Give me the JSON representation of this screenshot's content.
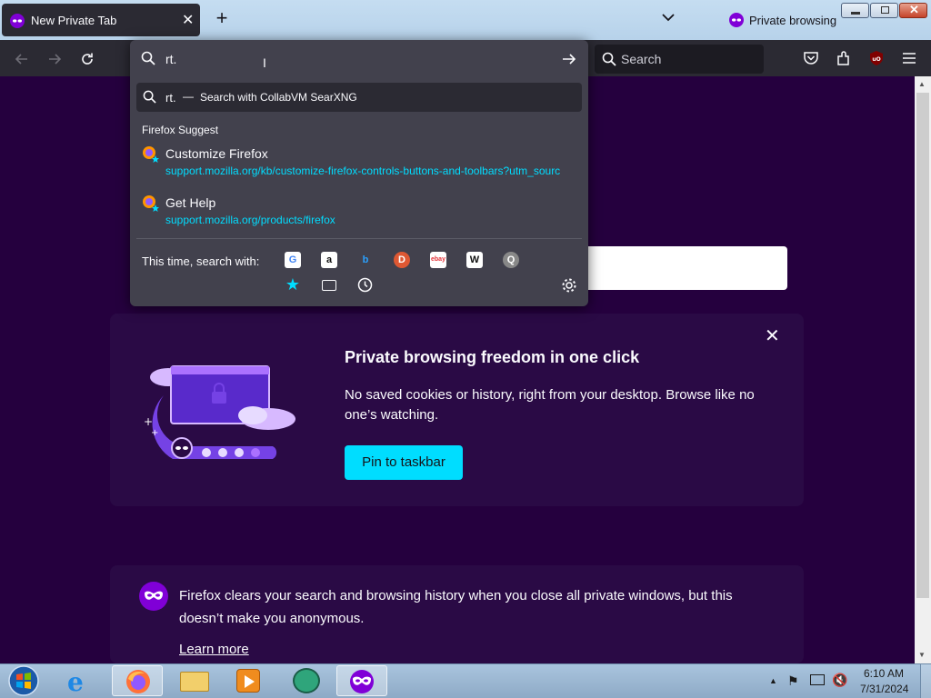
{
  "browser": {
    "tab_title": "New Private Tab",
    "private_label": "Private browsing",
    "search_placeholder": "Search"
  },
  "urlbar": {
    "value": "rt.",
    "search_row": {
      "query": "rt.",
      "separator": "—",
      "action": "Search with CollabVM SearXNG"
    },
    "suggest_heading": "Firefox Suggest",
    "suggestions": [
      {
        "title": "Customize Firefox",
        "url": "support.mozilla.org/kb/customize-firefox-controls-buttons-and-toolbars?utm_sourc"
      },
      {
        "title": "Get Help",
        "url": "support.mozilla.org/products/firefox"
      }
    ],
    "one_off_label": "This time, search with:",
    "engines": [
      "google-icon",
      "amazon-icon",
      "bing-icon",
      "duckduckgo-icon",
      "ebay-icon",
      "wikipedia-icon",
      "searxng-icon"
    ],
    "engine_glyphs": [
      "G",
      "a",
      "b",
      "D",
      "ebay",
      "W",
      "Q"
    ],
    "modes": [
      "bookmarks-icon",
      "tabs-icon",
      "history-icon"
    ]
  },
  "promo": {
    "title": "Private browsing freedom in one click",
    "text": "No saved cookies or history, right from your desktop. Browse like no one’s watching.",
    "button": "Pin to taskbar"
  },
  "info": {
    "text": "Firefox clears your search and browsing history when you close all private windows, but this doesn’t make you anonymous.",
    "link": "Learn more"
  },
  "taskbar": {
    "time": "6:10 AM",
    "date": "7/31/2024"
  },
  "colors": {
    "page_bg": "#25003e",
    "accent": "#00ddff",
    "private_purple": "#8000d7"
  }
}
